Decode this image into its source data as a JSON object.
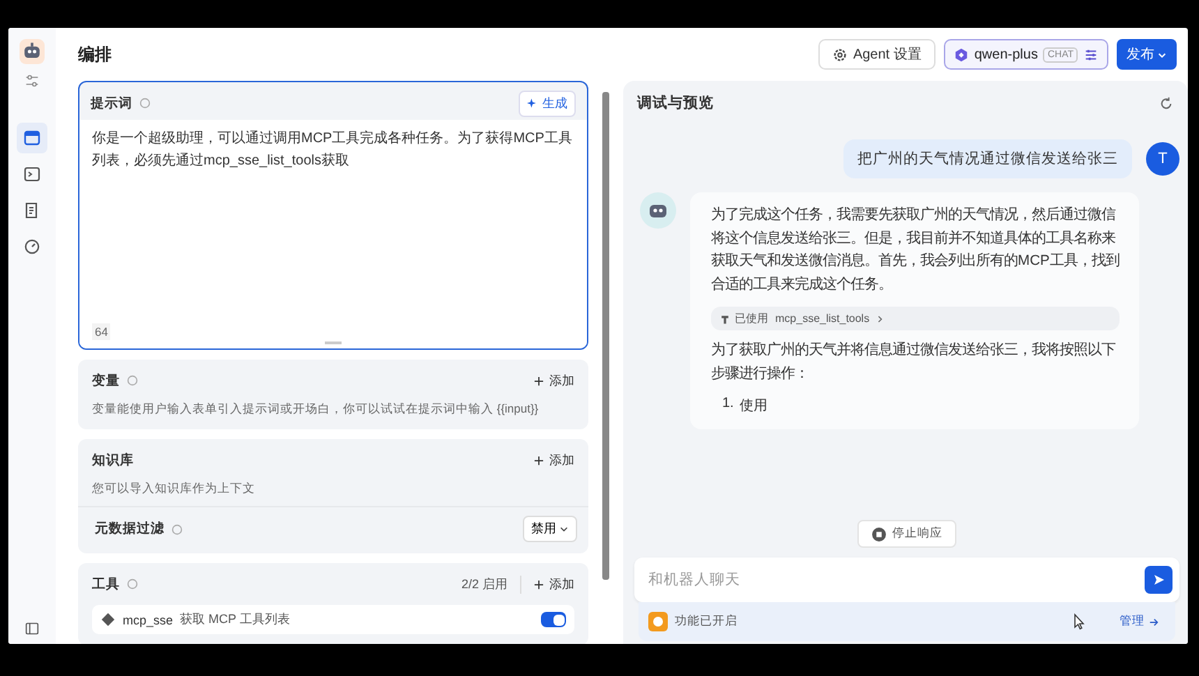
{
  "sidebar": {
    "nav_items": [
      {
        "kind": "layout",
        "selected": true
      },
      {
        "kind": "terminal",
        "selected": false
      },
      {
        "kind": "document",
        "selected": false
      },
      {
        "kind": "gauge",
        "selected": false
      }
    ]
  },
  "header": {
    "title": "编排",
    "agent_settings": "Agent 设置",
    "model": "qwen-plus",
    "model_badge": "CHAT",
    "publish": "发布"
  },
  "prompt": {
    "title": "提示词",
    "generate": "生成",
    "text": "你是一个超级助理，可以通过调用MCP工具完成各种任务。为了获得MCP工具列表，必须先通过mcp_sse_list_tools获取",
    "count": "64"
  },
  "variables": {
    "title": "变量",
    "add": "添加",
    "description": "变量能使用户输入表单引入提示词或开场白，你可以试试在提示词中输入 {{input}}"
  },
  "knowledge": {
    "title": "知识库",
    "add": "添加",
    "description": "您可以导入知识库作为上下文",
    "filter_label": "元数据过滤",
    "filter_value": "禁用"
  },
  "tools": {
    "title": "工具",
    "count": "2/2 启用",
    "add": "添加",
    "items": [
      {
        "name": "mcp_sse",
        "description": "获取 MCP 工具列表",
        "on": true
      }
    ]
  },
  "preview": {
    "title": "调试与预览",
    "messages": [
      {
        "kind": "user",
        "avatar": "T",
        "text": "把广州的天气情况通过微信发送给张三"
      },
      {
        "kind": "bot",
        "parts": [
          {
            "kind": "text",
            "text": "为了完成这个任务，我需要先获取广州的天气情况，然后通过微信将这个信息发送给张三。但是，我目前并不知道具体的工具名称来获取天气和发送微信消息。首先，我会列出所有的MCP工具，找到合适的工具来完成这个任务。"
          },
          {
            "kind": "tool",
            "label": "已使用",
            "tool": "mcp_sse_list_tools"
          },
          {
            "kind": "text",
            "text": "为了获取广州的天气并将信息通过微信发送给张三，我将按照以下步骤进行操作："
          },
          {
            "kind": "list",
            "items": [
              {
                "number": "1.",
                "text": "使用"
              }
            ]
          }
        ]
      }
    ],
    "stop": "停止响应",
    "input_placeholder": "和机器人聊天",
    "feature": "功能已开启",
    "manage": "管理"
  }
}
